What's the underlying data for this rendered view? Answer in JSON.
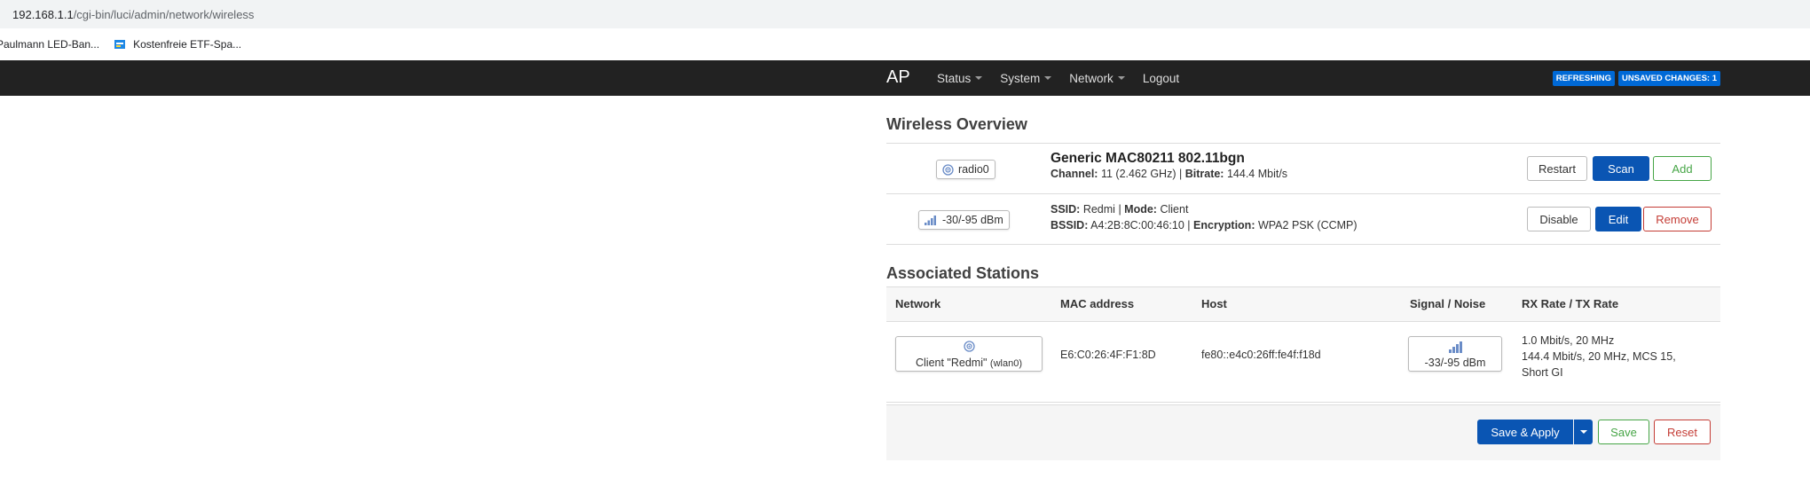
{
  "browser": {
    "url_host": "192.168.1.1",
    "url_path": "/cgi-bin/luci/admin/network/wireless",
    "bookmarks": [
      {
        "label": "Paulmann LED-Ban..."
      },
      {
        "label": "Kostenfreie ETF-Spa..."
      }
    ]
  },
  "header": {
    "brand": "AP",
    "menu": [
      {
        "label": "Status",
        "dropdown": true
      },
      {
        "label": "System",
        "dropdown": true
      },
      {
        "label": "Network",
        "dropdown": true
      },
      {
        "label": "Logout",
        "dropdown": false
      }
    ],
    "badges": {
      "refreshing": "REFRESHING",
      "unsaved": "UNSAVED CHANGES: 1"
    }
  },
  "wireless": {
    "title": "Wireless Overview",
    "device": {
      "badge": "radio0",
      "name": "Generic MAC80211 802.11bgn",
      "channel_label": "Channel:",
      "channel": "11 (2.462 GHz)",
      "sep": "|",
      "bitrate_label": "Bitrate:",
      "bitrate": "144.4 Mbit/s",
      "buttons": {
        "restart": "Restart",
        "scan": "Scan",
        "add": "Add"
      }
    },
    "network": {
      "signal_badge": "-30/-95 dBm",
      "ssid_label": "SSID:",
      "ssid": "Redmi",
      "mode_label": "Mode:",
      "mode": "Client",
      "bssid_label": "BSSID:",
      "bssid": "A4:2B:8C:00:46:10",
      "enc_label": "Encryption:",
      "encryption": "WPA2 PSK (CCMP)",
      "buttons": {
        "disable": "Disable",
        "edit": "Edit",
        "remove": "Remove"
      }
    }
  },
  "stations": {
    "title": "Associated Stations",
    "columns": [
      "Network",
      "MAC address",
      "Host",
      "Signal / Noise",
      "RX Rate / TX Rate"
    ],
    "rows": [
      {
        "network": "Client \"Redmi\"",
        "iface": "(wlan0)",
        "mac": "E6:C0:26:4F:F1:8D",
        "host": "fe80::e4c0:26ff:fe4f:f18d",
        "signal": "-33/-95 dBm",
        "rx_rate": "1.0 Mbit/s, 20 MHz",
        "tx_rate_1": "144.4 Mbit/s, 20 MHz, MCS 15,",
        "tx_rate_2": "Short GI"
      }
    ]
  },
  "actions": {
    "save_apply": "Save & Apply",
    "save": "Save",
    "reset": "Reset"
  },
  "colors": {
    "primary": "#0a55b3",
    "save": "#46a546",
    "reset": "#c43c35",
    "navbar": "#222222"
  }
}
